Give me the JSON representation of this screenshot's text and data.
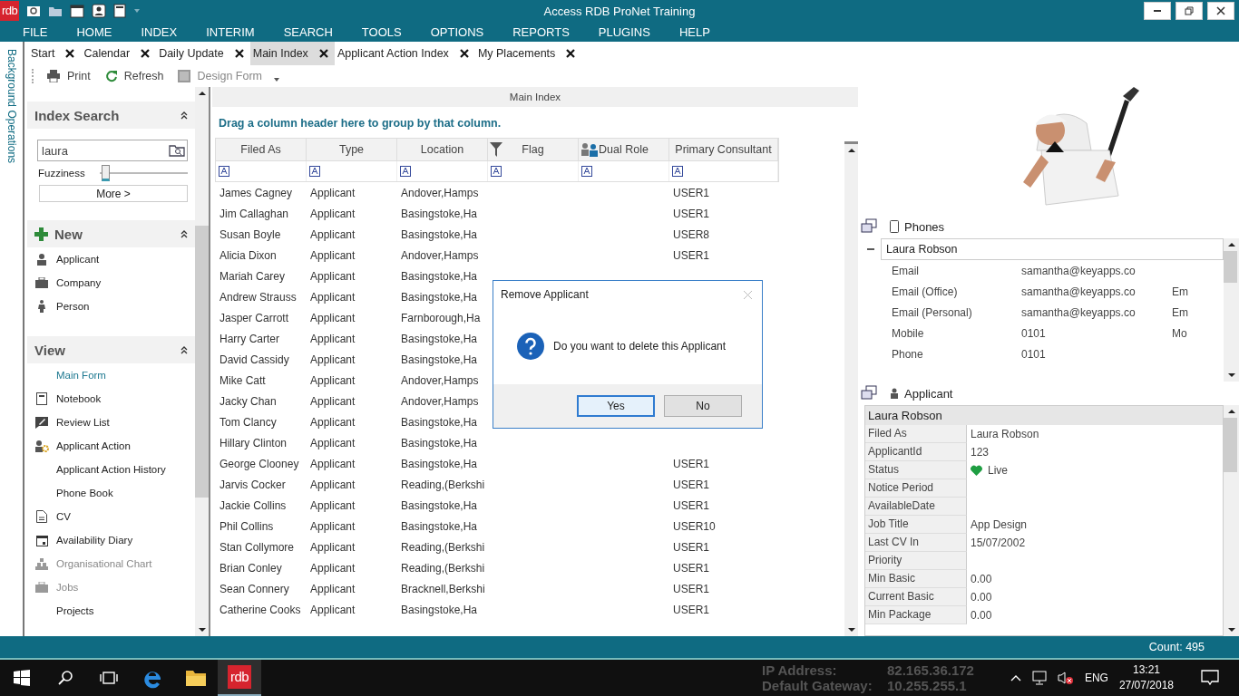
{
  "title_bar": {
    "logo": "rdb",
    "title": "Access RDB ProNet Training"
  },
  "menu": [
    "FILE",
    "HOME",
    "INDEX",
    "INTERIM",
    "SEARCH",
    "TOOLS",
    "OPTIONS",
    "REPORTS",
    "PLUGINS",
    "HELP"
  ],
  "side_strip": "Background Operations",
  "tabs": [
    {
      "label": "Start",
      "selected": false
    },
    {
      "label": "Calendar",
      "selected": false
    },
    {
      "label": "Daily Update",
      "selected": false
    },
    {
      "label": "Main Index",
      "selected": true
    },
    {
      "label": "Applicant Action Index",
      "selected": false
    },
    {
      "label": "My Placements",
      "selected": false
    }
  ],
  "toolbar": [
    {
      "label": "Print",
      "disabled": false
    },
    {
      "label": "Refresh",
      "disabled": false
    },
    {
      "label": "Design Form",
      "disabled": true
    }
  ],
  "index_search": {
    "title": "Index Search",
    "query": "laura",
    "fuzziness_label": "Fuzziness",
    "fuzziness": {
      "level": 0.03
    },
    "more": "More >"
  },
  "new_section": {
    "title": "New",
    "items": [
      "Applicant",
      "Company",
      "Person"
    ]
  },
  "view_section": {
    "title": "View",
    "items": [
      {
        "label": "Main Form",
        "selected": true,
        "disabled": false
      },
      {
        "label": "Notebook",
        "selected": false,
        "disabled": false
      },
      {
        "label": "Review List",
        "selected": false,
        "disabled": false
      },
      {
        "label": "Applicant Action",
        "selected": false,
        "disabled": false
      },
      {
        "label": "Applicant Action History",
        "selected": false,
        "disabled": false
      },
      {
        "label": "Phone Book",
        "selected": false,
        "disabled": false
      },
      {
        "label": "CV",
        "selected": false,
        "disabled": false
      },
      {
        "label": "Availability Diary",
        "selected": false,
        "disabled": false
      },
      {
        "label": "Organisational Chart",
        "selected": false,
        "disabled": true
      },
      {
        "label": "Jobs",
        "selected": false,
        "disabled": true
      },
      {
        "label": "Projects",
        "selected": false,
        "disabled": false
      }
    ]
  },
  "grid": {
    "title": "Main Index",
    "group_hint": "Drag a column header here to group by that column.",
    "columns": [
      "Filed As",
      "Type",
      "Location",
      "Flag",
      "Dual Role",
      "Primary Consultant"
    ],
    "rows": [
      {
        "filed_as": "James Cagney",
        "type": "Applicant",
        "location": "Andover,Hamps",
        "consultant": "USER1"
      },
      {
        "filed_as": "Jim Callaghan",
        "type": "Applicant",
        "location": "Basingstoke,Ha",
        "consultant": "USER1"
      },
      {
        "filed_as": "Susan Boyle",
        "type": "Applicant",
        "location": "Basingstoke,Ha",
        "consultant": "USER8"
      },
      {
        "filed_as": "Alicia Dixon",
        "type": "Applicant",
        "location": "Andover,Hamps",
        "consultant": "USER1"
      },
      {
        "filed_as": "Mariah Carey",
        "type": "Applicant",
        "location": "Basingstoke,Ha"
      },
      {
        "filed_as": "Andrew Strauss",
        "type": "Applicant",
        "location": "Basingstoke,Ha"
      },
      {
        "filed_as": "Jasper Carrott",
        "type": "Applicant",
        "location": "Farnborough,Ha"
      },
      {
        "filed_as": "Harry Carter",
        "type": "Applicant",
        "location": "Basingstoke,Ha"
      },
      {
        "filed_as": "David Cassidy",
        "type": "Applicant",
        "location": "Basingstoke,Ha"
      },
      {
        "filed_as": "Mike Catt",
        "type": "Applicant",
        "location": "Andover,Hamps"
      },
      {
        "filed_as": "Jacky Chan",
        "type": "Applicant",
        "location": "Andover,Hamps"
      },
      {
        "filed_as": "Tom Clancy",
        "type": "Applicant",
        "location": "Basingstoke,Ha"
      },
      {
        "filed_as": "Hillary Clinton",
        "type": "Applicant",
        "location": "Basingstoke,Ha"
      },
      {
        "filed_as": "George Clooney",
        "type": "Applicant",
        "location": "Basingstoke,Ha",
        "consultant": "USER1"
      },
      {
        "filed_as": "Jarvis Cocker",
        "type": "Applicant",
        "location": "Reading,(Berkshi",
        "consultant": "USER1"
      },
      {
        "filed_as": "Jackie Collins",
        "type": "Applicant",
        "location": "Basingstoke,Ha",
        "consultant": "USER1"
      },
      {
        "filed_as": "Phil Collins",
        "type": "Applicant",
        "location": "Basingstoke,Ha",
        "consultant": "USER10"
      },
      {
        "filed_as": "Stan Collymore",
        "type": "Applicant",
        "location": "Reading,(Berkshi",
        "consultant": "USER1"
      },
      {
        "filed_as": "Brian Conley",
        "type": "Applicant",
        "location": "Reading,(Berkshi",
        "consultant": "USER1"
      },
      {
        "filed_as": "Sean Connery",
        "type": "Applicant",
        "location": "Bracknell,Berkshi",
        "consultant": "USER1"
      },
      {
        "filed_as": "Catherine Cooks",
        "type": "Applicant",
        "location": "Basingstoke,Ha",
        "consultant": "USER1"
      }
    ]
  },
  "phones": {
    "title": "Phones",
    "contact": "Laura Robson",
    "expanded": true,
    "rows": [
      {
        "label": "Email",
        "value": "samantha@keyapps.co"
      },
      {
        "label": "Email (Office)",
        "value": "samantha@keyapps.co",
        "column_3": "Em"
      },
      {
        "label": "Email (Personal)",
        "value": "samantha@keyapps.co",
        "column_3": "Em"
      },
      {
        "label": "Mobile",
        "value": "0101",
        "column_3": "Mo"
      },
      {
        "label": "Phone",
        "value": "0101"
      }
    ]
  },
  "applicant": {
    "title": "Applicant",
    "name": "Laura Robson",
    "fields": [
      {
        "label": "Filed As",
        "value": "Laura Robson"
      },
      {
        "label": "ApplicantId",
        "value": "123"
      },
      {
        "label": "Status",
        "value": "Live",
        "kind": "status"
      },
      {
        "label": "Notice Period"
      },
      {
        "label": "AvailableDate"
      },
      {
        "label": "Job Title",
        "value": "App Design"
      },
      {
        "label": "Last CV In",
        "value": "15/07/2002"
      },
      {
        "label": "Priority"
      },
      {
        "label": "Min Basic",
        "value": "0.00"
      },
      {
        "label": "Current Basic",
        "value": "0.00"
      },
      {
        "label": "Min Package",
        "value": "0.00"
      }
    ]
  },
  "dialog": {
    "title": "Remove Applicant",
    "message": "Do you want to delete this Applicant",
    "buttons": [
      {
        "label": "Yes",
        "default": true
      },
      {
        "label": "No",
        "default": false
      }
    ]
  },
  "status_bar": {
    "count": "Count: 495"
  },
  "taskbar": {
    "app_logo": "rdb",
    "bginfo": [
      {
        "label": "IP Address:",
        "value": "82.165.36.172"
      },
      {
        "label": "Default Gateway:",
        "value": "10.255.255.1"
      }
    ],
    "volume_muted": true,
    "language": "ENG",
    "time": "13:21",
    "date": "27/07/2018"
  }
}
